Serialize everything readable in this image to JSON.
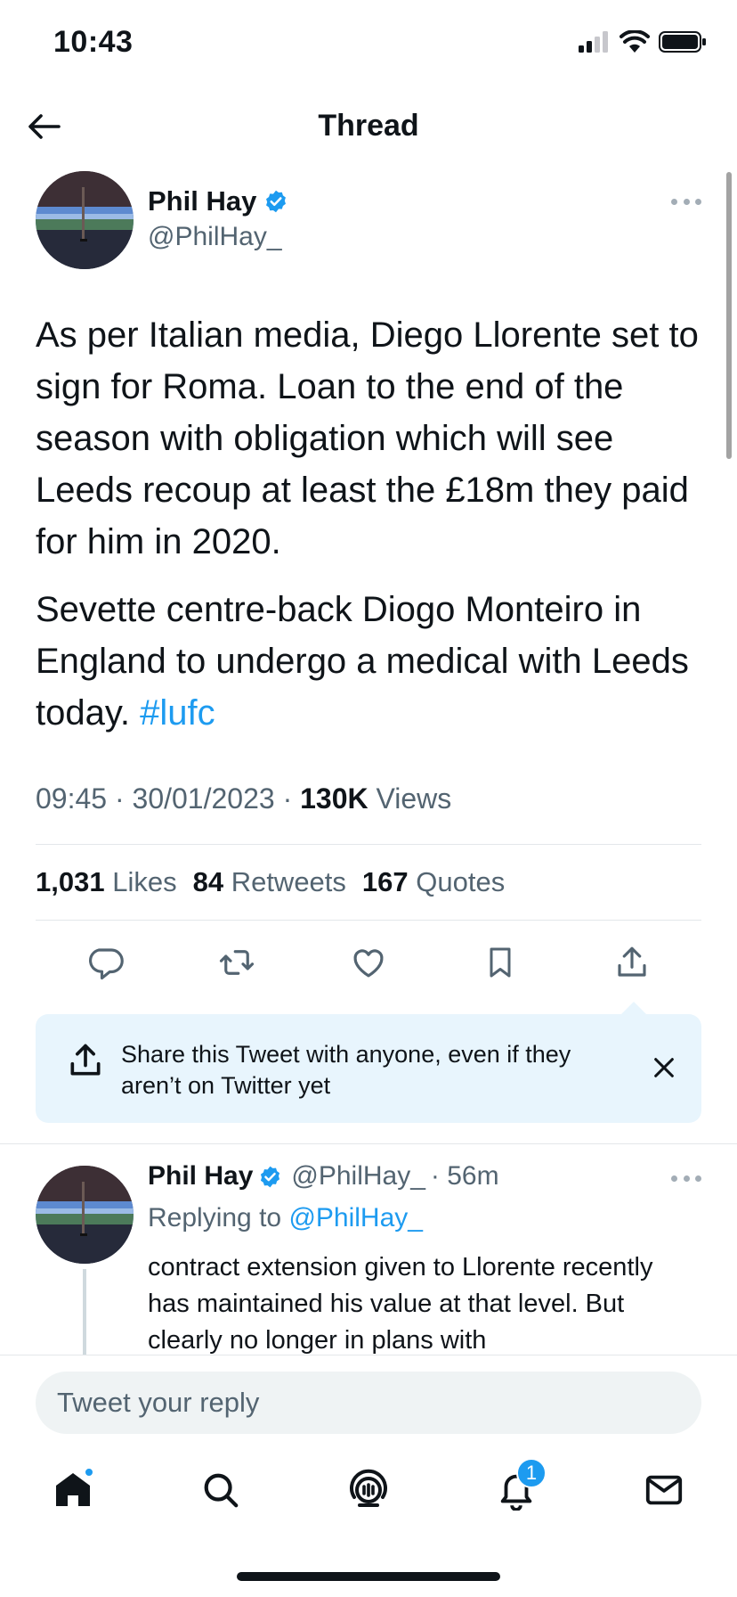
{
  "status_bar": {
    "time": "10:43"
  },
  "nav": {
    "title": "Thread"
  },
  "main_tweet": {
    "author_name": "Phil Hay",
    "author_handle": "@PhilHay_",
    "paragraph_1": "As per Italian media, Diego Llorente set to sign for Roma. Loan to the end of the season with obligation which will see Leeds recoup at least the £18m they paid for him in 2020.",
    "paragraph_2_text": "Sevette centre-back Diogo Monteiro in England to undergo a medical with Leeds today. ",
    "hashtag": "#lufc",
    "time": "09:45",
    "date": "30/01/2023",
    "views_count": "130K",
    "views_label": "Views",
    "likes_count": "1,031",
    "likes_label": "Likes",
    "retweets_count": "84",
    "retweets_label": "Retweets",
    "quotes_count": "167",
    "quotes_label": "Quotes"
  },
  "share_banner": {
    "text": "Share this Tweet with anyone, even if they aren’t on Twitter yet"
  },
  "reply_tweet": {
    "author_name": "Phil Hay",
    "author_handle": "@PhilHay_",
    "age": "· 56m",
    "replying_prefix": "Replying to",
    "replying_to": "@PhilHay_",
    "text": "contract extension given to Llorente recently has maintained his value at that level. But clearly no longer in plans with"
  },
  "composer": {
    "placeholder": "Tweet your reply"
  },
  "tab_bar": {
    "notifications_badge": "1"
  },
  "colors": {
    "accent": "#1d9bf0",
    "text": "#0f1419",
    "secondary": "#536471",
    "banner_bg": "#e8f5fd"
  }
}
